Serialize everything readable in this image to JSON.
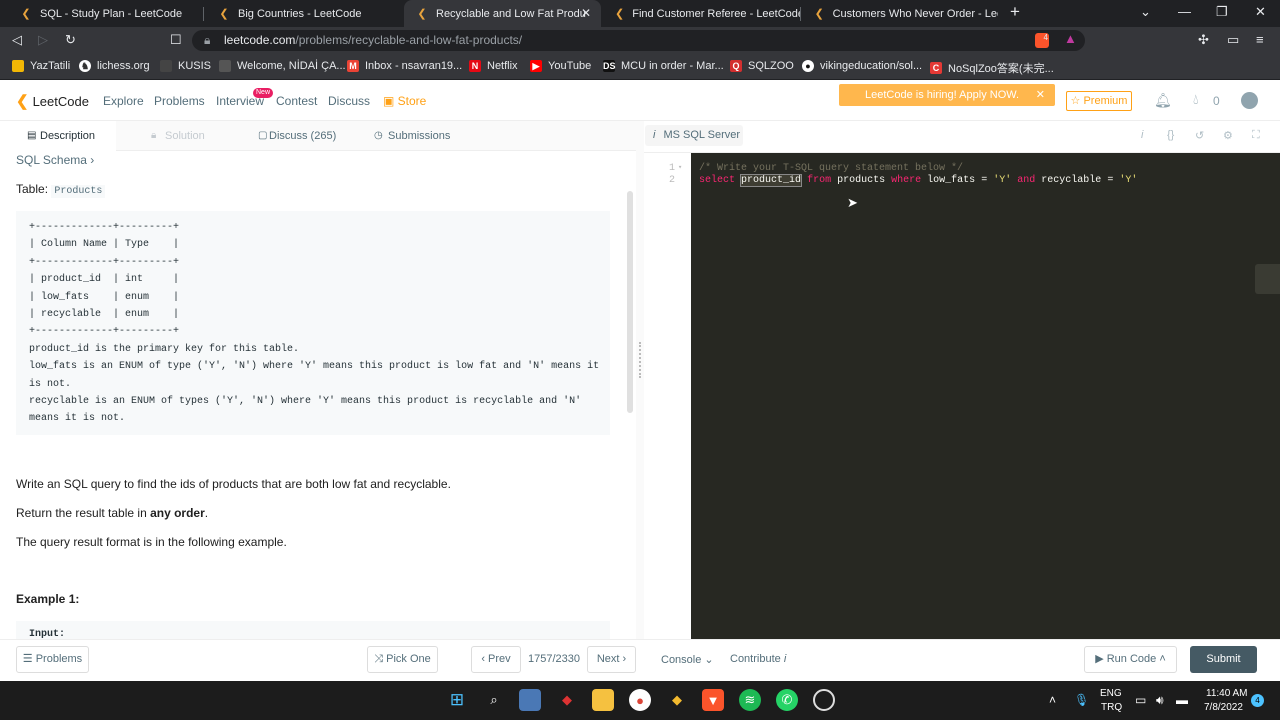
{
  "browser": {
    "tabs": [
      {
        "title": "SQL - Study Plan - LeetCode",
        "active": false
      },
      {
        "title": "Big Countries - LeetCode",
        "active": false
      },
      {
        "title": "Recyclable and Low Fat Products",
        "active": true
      },
      {
        "title": "Find Customer Referee - LeetCode",
        "active": false
      },
      {
        "title": "Customers Who Never Order - LeetCo",
        "active": false
      }
    ],
    "url_host": "leetcode.com",
    "url_path": "/problems/recyclable-and-low-fat-products/",
    "bookmarks": [
      "YazTatili",
      "lichess.org",
      "KUSIS",
      "Welcome, NİDAİ ÇA...",
      "Inbox - nsavran19...",
      "Netflix",
      "YouTube",
      "MCU in order - Mar...",
      "SQLZOO",
      "vikingeducation/sol...",
      "NoSqlZoo答案(未完..."
    ],
    "shield_count": "4"
  },
  "leetcode_nav": {
    "logo": "LeetCode",
    "links": [
      "Explore",
      "Problems",
      "Interview",
      "Contest",
      "Discuss",
      "Store"
    ],
    "new_badge": "New",
    "hiring_banner": "LeetCode is hiring! Apply NOW.",
    "premium": "Premium",
    "coins": "0"
  },
  "left_tabs": [
    {
      "label": "Description",
      "icon": "description-icon"
    },
    {
      "label": "Solution",
      "icon": "lock-icon"
    },
    {
      "label": "Discuss (265)",
      "icon": "chat-icon"
    },
    {
      "label": "Submissions",
      "icon": "clock-icon"
    }
  ],
  "problem": {
    "schema_link": "SQL Schema ›",
    "table_label": "Table: ",
    "table_name": "Products",
    "schema_block": "+-------------+---------+\n| Column Name | Type    |\n+-------------+---------+\n| product_id  | int     |\n| low_fats    | enum    |\n| recyclable  | enum    |\n+-------------+---------+\nproduct_id is the primary key for this table.\nlow_fats is an ENUM of type ('Y', 'N') where 'Y' means this product is low fat and 'N' means it\nis not.\nrecyclable is an ENUM of types ('Y', 'N') where 'Y' means this product is recyclable and 'N'\nmeans it is not.",
    "para1": "Write an SQL query to find the ids of products that are both low fat and recyclable.",
    "para2_pre": "Return the result table in ",
    "para2_bold": "any order",
    "para2_post": ".",
    "para3": "The query result format is in the following example.",
    "example_title": "Example 1:",
    "input_label": "Input:"
  },
  "editor": {
    "language": "MS SQL Server",
    "line_numbers": [
      "1",
      "2"
    ],
    "line1_comment": "/* Write your T-SQL query statement below */",
    "line2": {
      "select": "select",
      "column": "product_id",
      "from": "from",
      "table": "products",
      "where": "where",
      "col1": "low_fats",
      "eq1": "=",
      "val1": "'Y'",
      "and": "and",
      "col2": "recyclable",
      "eq2": "=",
      "val2": "'Y'"
    }
  },
  "bottom": {
    "problems": "Problems",
    "pick_one": "Pick One",
    "prev": "Prev",
    "pager": "1757/2330",
    "next": "Next",
    "console": "Console",
    "contribute": "Contribute",
    "run_code": "Run Code",
    "submit": "Submit"
  },
  "taskbar": {
    "lang_top": "ENG",
    "lang_bottom": "TRQ",
    "time": "11:40 AM",
    "date": "7/8/2022",
    "notif_count": "4"
  }
}
